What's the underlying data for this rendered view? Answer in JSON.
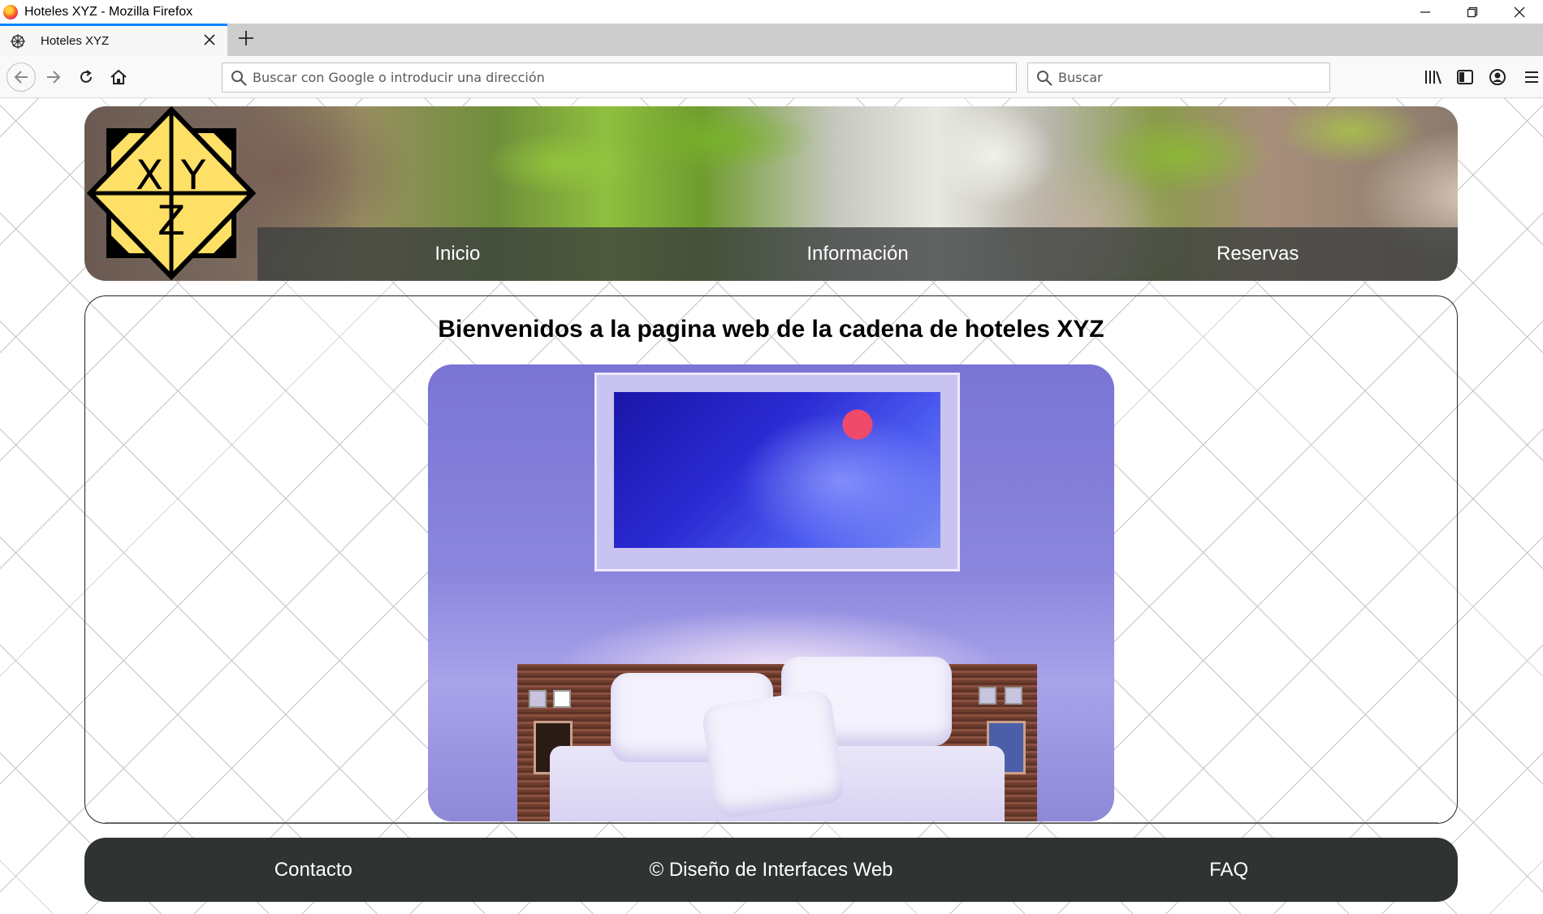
{
  "window": {
    "title": "Hoteles XYZ - Mozilla Firefox"
  },
  "tabs": [
    {
      "label": "Hoteles XYZ"
    }
  ],
  "toolbar": {
    "url_placeholder": "Buscar con Google o introducir una dirección",
    "search_placeholder": "Buscar"
  },
  "logo": {
    "letters": [
      "X",
      "Y",
      "Z"
    ]
  },
  "nav": {
    "items": [
      "Inicio",
      "Información",
      "Reservas"
    ]
  },
  "main": {
    "title": "Bienvenidos a la pagina web de la cadena de hoteles XYZ"
  },
  "footer": {
    "contact": "Contacto",
    "copyright": "© Diseño de Interfaces Web",
    "faq": "FAQ"
  },
  "colors": {
    "logo_fill": "#ffe066",
    "menu_bar": "#3a3e3e",
    "footer_bg": "#2f3332",
    "tab_accent": "#0a84ff"
  }
}
